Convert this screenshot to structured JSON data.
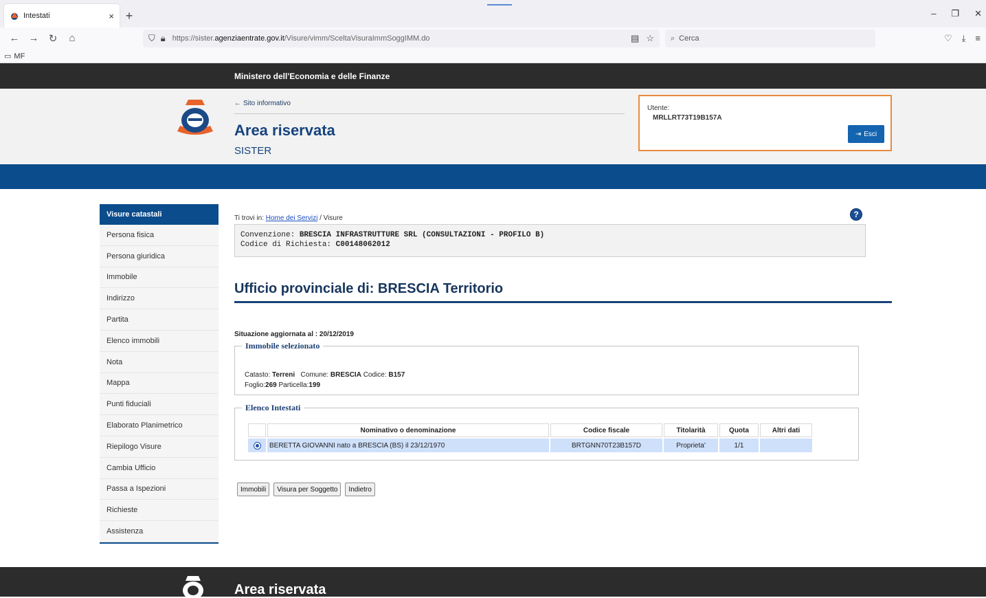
{
  "browser": {
    "tab_title": "Intestati",
    "tab_close": "×",
    "new_tab": "+",
    "url_prefix": "https://sister.",
    "url_domain": "agenziaentrate.gov.it",
    "url_path": "/Visure/vimm/SceltaVisuraImmSoggIMM.do",
    "search_placeholder": "Cerca",
    "bookmark_folder": "MF"
  },
  "site": {
    "ministry": "Ministero dell'Economia e delle Finanze",
    "back_link": "Sito informativo",
    "area_title": "Area riservata",
    "area_subtitle": "SISTER",
    "user_label": "Utente:",
    "user_code": "MRLLRT73T19B157A",
    "logout_label": "Esci",
    "accent_color": "#0b4c8c",
    "highlight_border": "#e88a3c"
  },
  "sidebar": {
    "header": "Visure catastali",
    "items": [
      "Persona fisica",
      "Persona giuridica",
      "Immobile",
      "Indirizzo",
      "Partita",
      "Elenco immobili",
      "Nota",
      "Mappa",
      "Punti fiduciali",
      "Elaborato Planimetrico",
      "Riepilogo Visure",
      "Cambia Ufficio",
      "Passa a Ispezioni",
      "Richieste",
      "Assistenza"
    ]
  },
  "breadcrumb": {
    "prefix": "Ti trovi in:",
    "link": "Home dei Servizi",
    "current": "/ Visure"
  },
  "convenzione": {
    "label": "Convenzione:",
    "value": "BRESCIA INFRASTRUTTURE SRL (CONSULTAZIONI - PROFILO B)",
    "codice_label": "Codice di Richiesta:",
    "codice_value": "C00148062012"
  },
  "ufficio_title": "Ufficio provinciale di: BRESCIA Territorio",
  "situazione": "Situazione aggiornata al : 20/12/2019",
  "immobile": {
    "legend": "Immobile selezionato",
    "catasto_label": "Catasto:",
    "catasto_value": "Terreni",
    "comune_label": "Comune:",
    "comune_value": "BRESCIA",
    "codice_label": "Codice:",
    "codice_value": "B157",
    "foglio_label": "Foglio:",
    "foglio_value": "269",
    "particella_label": "Particella:",
    "particella_value": "199"
  },
  "intestati": {
    "legend": "Elenco Intestati",
    "columns": [
      "Nominativo o denominazione",
      "Codice fiscale",
      "Titolarità",
      "Quota",
      "Altri dati"
    ],
    "rows": [
      {
        "nominativo": "BERETTA GIOVANNI nato a BRESCIA (BS) il 23/12/1970",
        "codice_fiscale": "BRTGNN70T23B157D",
        "titolarita": "Proprieta'",
        "quota": "1/1",
        "altri_dati": ""
      }
    ]
  },
  "buttons": {
    "immobili": "Immobili",
    "visura_soggetto": "Visura per Soggetto",
    "indietro": "Indietro"
  },
  "footer": {
    "title": "Area riservata"
  }
}
